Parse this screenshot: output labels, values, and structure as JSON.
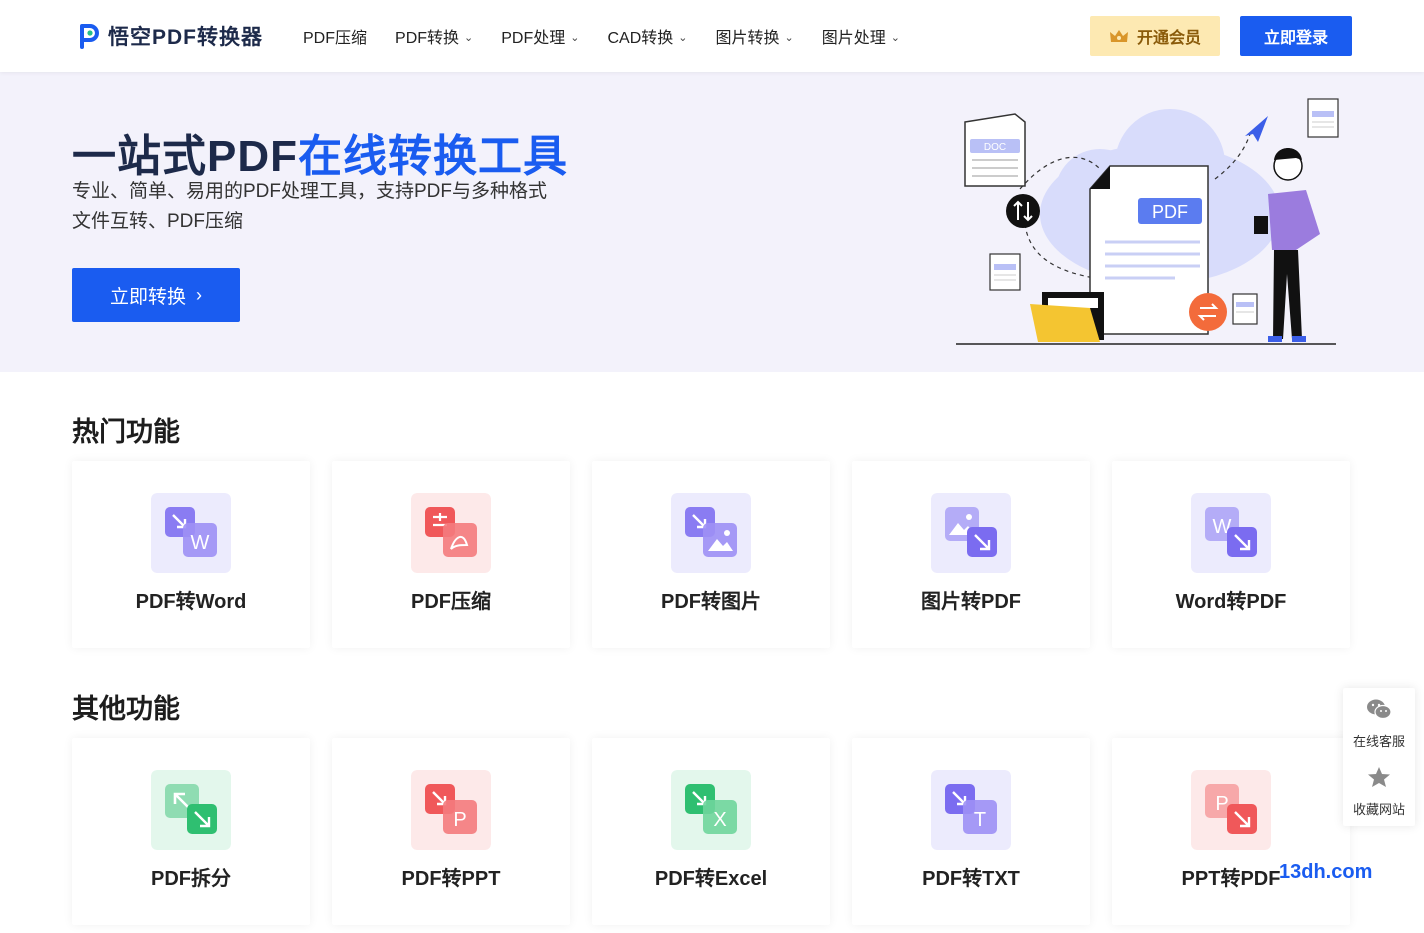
{
  "header": {
    "brand": "悟空PDF转换器",
    "nav": [
      {
        "label": "PDF压缩",
        "dropdown": false
      },
      {
        "label": "PDF转换",
        "dropdown": true
      },
      {
        "label": "PDF处理",
        "dropdown": true
      },
      {
        "label": "CAD转换",
        "dropdown": true
      },
      {
        "label": "图片转换",
        "dropdown": true
      },
      {
        "label": "图片处理",
        "dropdown": true
      }
    ],
    "vip_label": "开通会员",
    "login_label": "立即登录"
  },
  "hero": {
    "title_plain": "一站式PDF",
    "title_accent": "在线转换工具",
    "subtitle": "专业、简单、易用的PDF处理工具，支持PDF与多种格式文件互转、PDF压缩",
    "cta_label": "立即转换",
    "illustration": {
      "doc_tag": "DOC",
      "pdf_tag": "PDF"
    }
  },
  "hot": {
    "title": "热门功能",
    "items": [
      {
        "label": "PDF转Word",
        "icon": "pdf-to-word-icon",
        "glyph": "W",
        "color": "#7b6cf0",
        "bg": "#ecebfd"
      },
      {
        "label": "PDF压缩",
        "icon": "pdf-compress-icon",
        "glyph": "",
        "color": "#f0585a",
        "bg": "#fde9e9"
      },
      {
        "label": "PDF转图片",
        "icon": "pdf-to-image-icon",
        "glyph": "",
        "color": "#7b6cf0",
        "bg": "#ecebfd"
      },
      {
        "label": "图片转PDF",
        "icon": "image-to-pdf-icon",
        "glyph": "",
        "color": "#7b6cf0",
        "bg": "#ecebfd"
      },
      {
        "label": "Word转PDF",
        "icon": "word-to-pdf-icon",
        "glyph": "W",
        "color": "#7b6cf0",
        "bg": "#ecebfd"
      }
    ]
  },
  "other": {
    "title": "其他功能",
    "items": [
      {
        "label": "PDF拆分",
        "icon": "pdf-split-icon",
        "glyph": "",
        "color": "#2fbf71",
        "bg": "#e3f7ec"
      },
      {
        "label": "PDF转PPT",
        "icon": "pdf-to-ppt-icon",
        "glyph": "P",
        "color": "#f0585a",
        "bg": "#fde9e9"
      },
      {
        "label": "PDF转Excel",
        "icon": "pdf-to-excel-icon",
        "glyph": "X",
        "color": "#2fbf71",
        "bg": "#e3f7ec"
      },
      {
        "label": "PDF转TXT",
        "icon": "pdf-to-txt-icon",
        "glyph": "T",
        "color": "#7b6cf0",
        "bg": "#ecebfd"
      },
      {
        "label": "PPT转PDF",
        "icon": "ppt-to-pdf-icon",
        "glyph": "P",
        "color": "#f0585a",
        "bg": "#fde9e9"
      }
    ]
  },
  "side_panel": {
    "service_label": "在线客服",
    "favorite_label": "收藏网站"
  },
  "watermark": "13dh.com",
  "colors": {
    "brand_blue": "#1a5cf0",
    "hero_bg": "#f3f2fb",
    "vip_bg": "#fde9b2"
  }
}
